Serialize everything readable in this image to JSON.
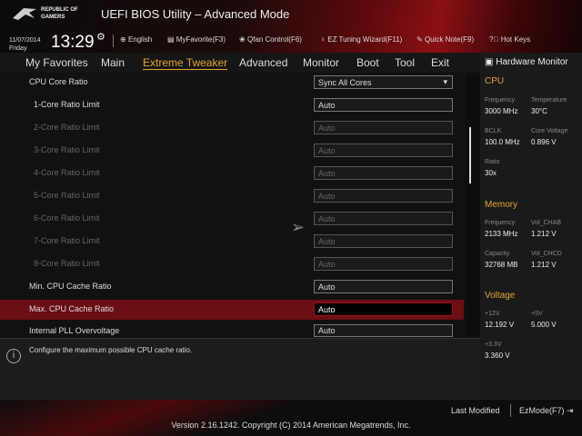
{
  "header": {
    "logo_text": "REPUBLIC OF GAMERS",
    "title": "UEFI BIOS Utility – Advanced Mode",
    "date": "11/07/2014",
    "day": "Friday",
    "time": "13:29"
  },
  "toolbar": [
    "English",
    "MyFavorite(F3)",
    "Qfan Control(F6)",
    "EZ Tuning Wizard(F11)",
    "Quick Note(F9)",
    "Hot Keys"
  ],
  "tabs": [
    "My Favorites",
    "Main",
    "Extreme Tweaker",
    "Advanced",
    "Monitor",
    "Boot",
    "Tool",
    "Exit"
  ],
  "active_tab": "Extreme Tweaker",
  "settings": [
    {
      "label": "CPU Core Ratio",
      "value": "Sync All Cores"
    },
    {
      "label": "1-Core Ratio Limit",
      "value": "Auto"
    },
    {
      "label": "2-Core Ratio Limit",
      "value": "Auto"
    },
    {
      "label": "3-Core Ratio Limit",
      "value": "Auto"
    },
    {
      "label": "4-Core Ratio Limit",
      "value": "Auto"
    },
    {
      "label": "5-Core Ratio Limit",
      "value": "Auto"
    },
    {
      "label": "6-Core Ratio Limit",
      "value": "Auto"
    },
    {
      "label": "7-Core Ratio Limit",
      "value": "Auto"
    },
    {
      "label": "8-Core Ratio Limit",
      "value": "Auto"
    },
    {
      "label": "Min. CPU Cache Ratio",
      "value": "Auto"
    },
    {
      "label": "Max. CPU Cache Ratio",
      "value": "Auto"
    },
    {
      "label": "Internal PLL Overvoltage",
      "value": "Auto"
    }
  ],
  "info_text": "Configure the maximum possible CPU cache ratio.",
  "hw": {
    "title": "Hardware Monitor",
    "cpu": {
      "title": "CPU",
      "freq_l": "Frequency",
      "freq": "3000 MHz",
      "temp_l": "Temperature",
      "temp": "30°C",
      "bclk_l": "BCLK",
      "bclk": "100.0 MHz",
      "cv_l": "Core Voltage",
      "cv": "0.896 V",
      "ratio_l": "Ratio",
      "ratio": "30x"
    },
    "mem": {
      "title": "Memory",
      "freq_l": "Frequency",
      "freq": "2133 MHz",
      "chab_l": "Vol_CHAB",
      "chab": "1.212 V",
      "cap_l": "Capacity",
      "cap": "32768 MB",
      "chcd_l": "Vol_CHCD",
      "chcd": "1.212 V"
    },
    "volt": {
      "title": "Voltage",
      "v12_l": "+12V",
      "v12": "12.192 V",
      "v5_l": "+5V",
      "v5": "5.000 V",
      "v33_l": "+3.3V",
      "v33": "3.360 V"
    }
  },
  "footer": {
    "last_modified": "Last Modified",
    "ezmode": "EzMode(F7)",
    "version": "Version 2.16.1242. Copyright (C) 2014 American Megatrends, Inc."
  }
}
